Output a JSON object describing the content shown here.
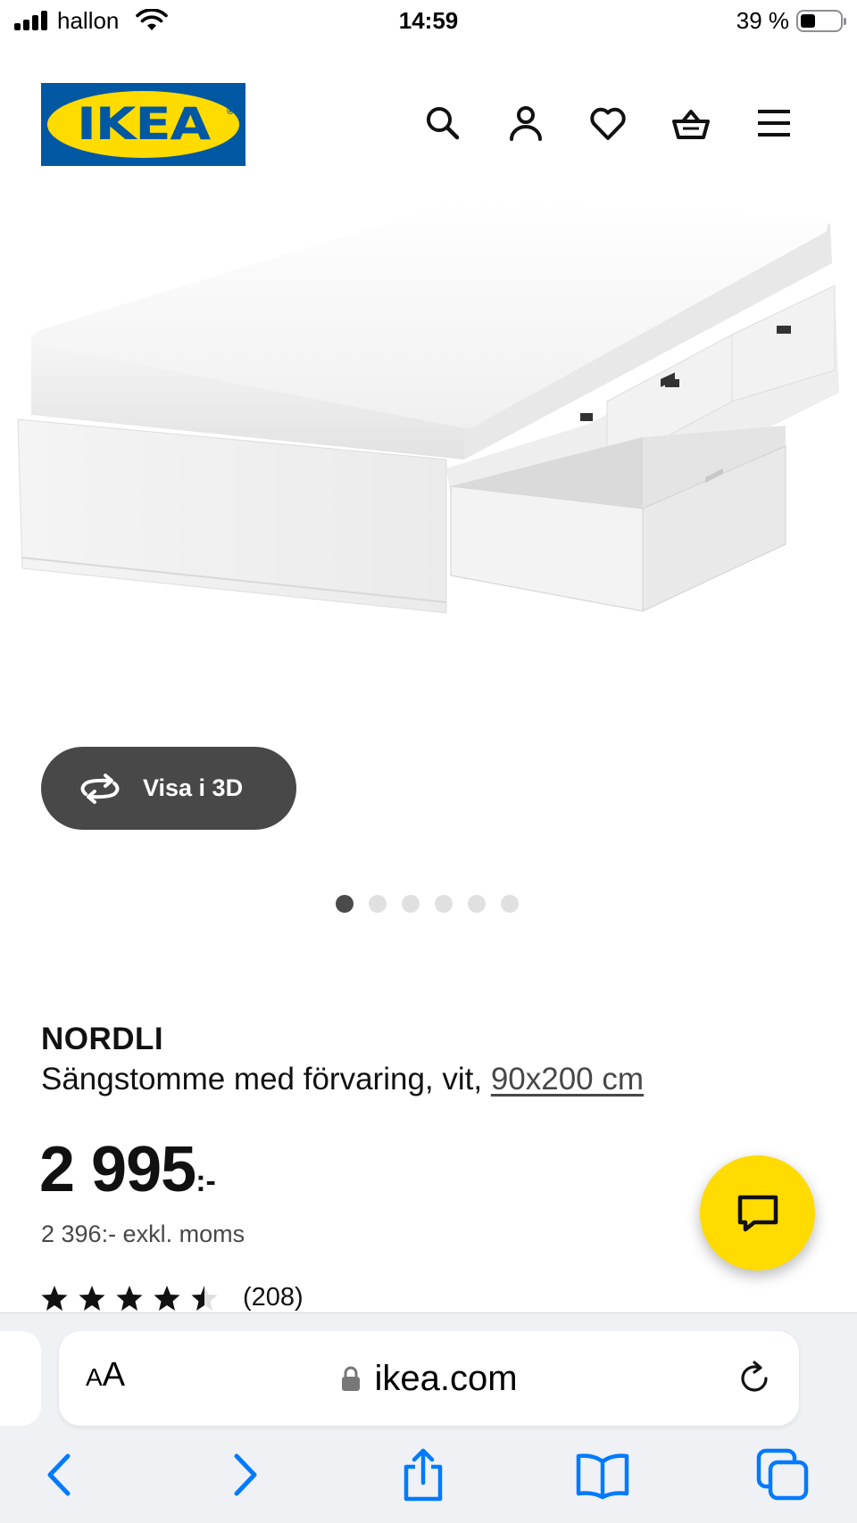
{
  "status_bar": {
    "carrier": "hallon",
    "time": "14:59",
    "battery_percent": "39 %",
    "battery_level": 0.39
  },
  "header": {
    "logo_text": "IKEA",
    "logo_registered": "®",
    "icons": [
      "search-icon",
      "user-icon",
      "heart-icon",
      "shopping-basket-icon",
      "hamburger-menu-icon"
    ],
    "brand_colors": {
      "blue": "#0058a3",
      "yellow": "#ffdb00"
    }
  },
  "gallery": {
    "view_3d_label": "Visa i 3D",
    "total_images": 6,
    "active_index": 0
  },
  "product": {
    "name": "NORDLI",
    "description": "Sängstomme med förvaring, vit, ",
    "size_link": "90x200 cm",
    "price_main": "2 995",
    "price_suffix": ":-",
    "price_excl_vat": "2 396:- exkl. moms",
    "rating_value": 4.5,
    "rating_max": 5,
    "review_count": "(208)"
  },
  "chat": {
    "icon": "chat-bubble-icon",
    "color": "#ffdb00"
  },
  "browser": {
    "text_size_small": "A",
    "text_size_big": "A",
    "url": "ikea.com",
    "toolbar": [
      "back-icon",
      "forward-icon",
      "share-icon",
      "bookmarks-icon",
      "tabs-icon"
    ],
    "accent": "#007aff"
  }
}
